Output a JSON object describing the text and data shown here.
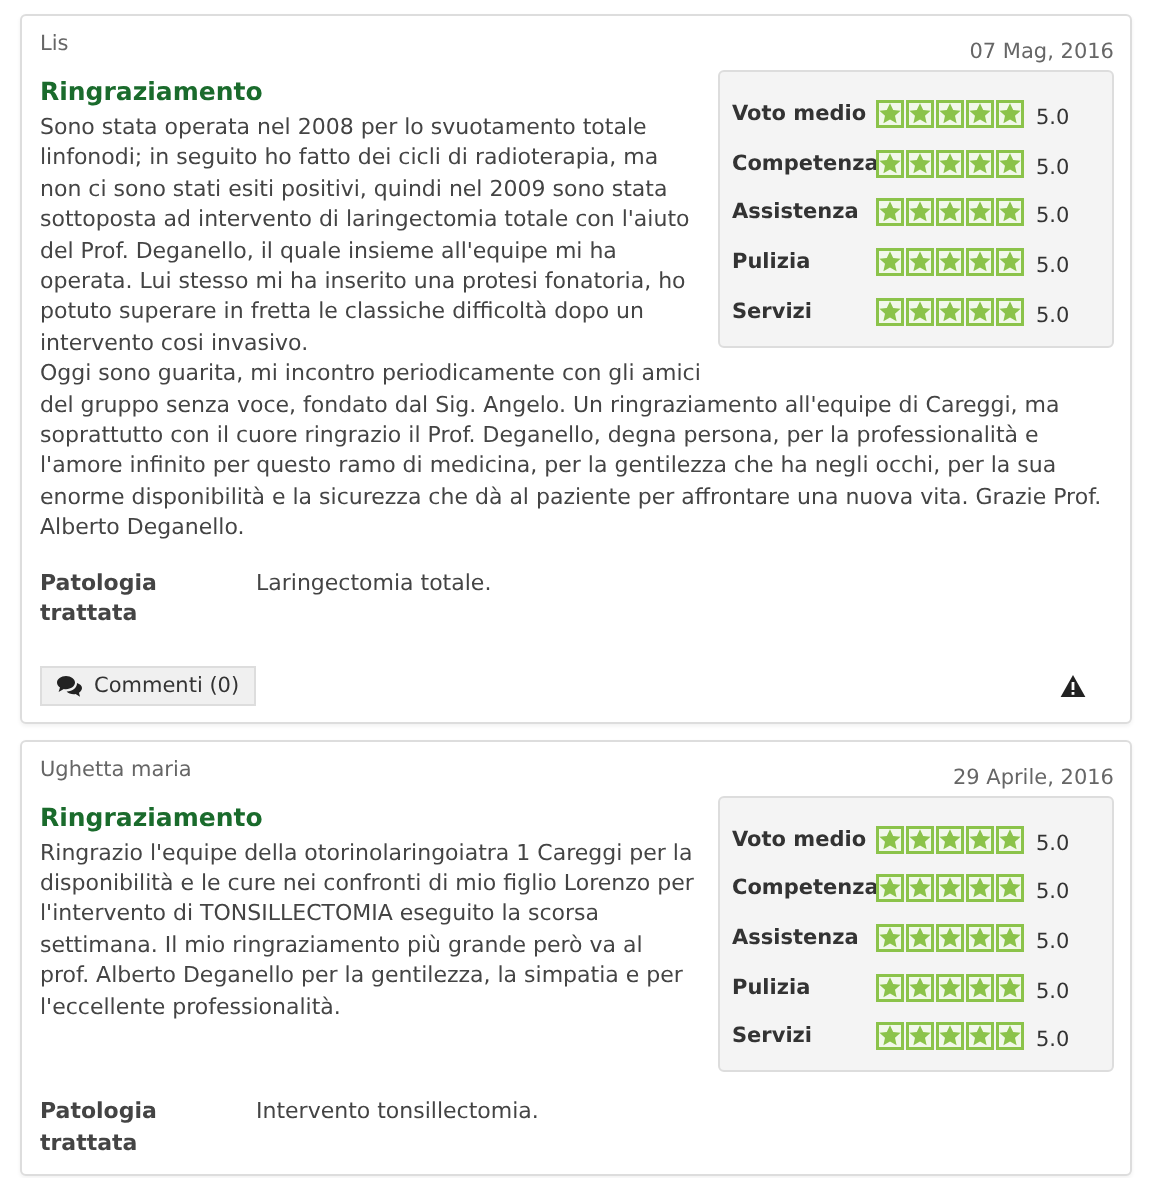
{
  "reviews": [
    {
      "author": "Lis",
      "date": "07 Mag, 2016",
      "title": "Ringraziamento",
      "side_text": "Sono stata operata nel 2008 per lo svuotamento totale linfonodi; in seguito ho fatto dei cicli di radioterapia, ma non ci sono stati esiti positivi, quindi nel 2009 sono stata sottoposta ad intervento di laringectomia totale con l'aiuto del Prof. Deganello, il quale insieme all'equipe mi ha operata. Lui stesso mi ha inserito una protesi fonatoria, ho potuto superare in fretta le classiche difficoltà dopo un intervento cosi invasivo.",
      "paragraphs": [
        "Oggi sono guarita, mi incontro periodicamente con gli amici",
        "del gruppo senza voce, fondato dal Sig. Angelo. Un ringraziamento all'equipe di Careggi, ma soprattutto con il cuore ringrazio il Prof. Deganello, degna persona, per la professionalità e l'amore infinito per questo ramo di medicina, per la gentilezza che ha negli occhi, per la sua enorme disponibilità e la sicurezza che dà al paziente per affrontare una nuova vita. Grazie Prof. Alberto Deganello."
      ],
      "ratings": [
        {
          "label": "Voto medio",
          "stars": 5,
          "score": "5.0"
        },
        {
          "label": "Competenza",
          "stars": 5,
          "score": "5.0"
        },
        {
          "label": "Assistenza",
          "stars": 5,
          "score": "5.0"
        },
        {
          "label": "Pulizia",
          "stars": 5,
          "score": "5.0"
        },
        {
          "label": "Servizi",
          "stars": 5,
          "score": "5.0"
        }
      ],
      "pathology": {
        "label": "Patologia trattata",
        "value": "Laringectomia totale."
      },
      "comments": "Commenti (0)"
    },
    {
      "author": "Ughetta maria",
      "date": "29 Aprile, 2016",
      "title": "Ringraziamento",
      "side_text": "Ringrazio l'equipe della otorinolaringoiatra 1 Careggi per la disponibilità e le cure nei confronti di mio figlio Lorenzo per l'intervento di TONSILLECTOMIA eseguito la scorsa settimana. Il mio ringraziamento più grande però va al prof. Alberto Deganello per la gentilezza, la simpatia e per l'eccellente professionalità.",
      "ratings": [
        {
          "label": "Voto medio",
          "stars": 5,
          "score": "5.0"
        },
        {
          "label": "Competenza",
          "stars": 5,
          "score": "5.0"
        },
        {
          "label": "Assistenza",
          "stars": 5,
          "score": "5.0"
        },
        {
          "label": "Pulizia",
          "stars": 5,
          "score": "5.0"
        },
        {
          "label": "Servizi",
          "stars": 5,
          "score": "5.0"
        }
      ],
      "pathology": {
        "label": "Patologia trattata",
        "value": "Intervento tonsillectomia."
      }
    }
  ]
}
